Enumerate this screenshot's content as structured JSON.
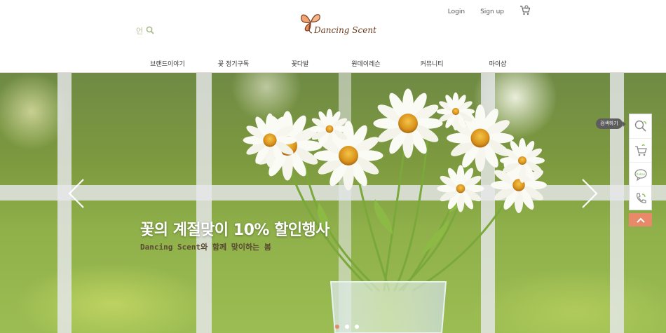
{
  "header": {
    "login_label": "Login",
    "signup_label": "Sign up",
    "language_label": "언",
    "cart_icon": "cart-icon",
    "search_icon": "search-icon"
  },
  "logo": {
    "text": "Dancing Scent"
  },
  "nav": {
    "items": [
      {
        "label": "브랜드이야기"
      },
      {
        "label": "꽃 정기구독"
      },
      {
        "label": "꽃다발"
      },
      {
        "label": "원데이레슨"
      },
      {
        "label": "커뮤니티"
      },
      {
        "label": "마이샵"
      }
    ]
  },
  "hero": {
    "title": "꽃의 계절맞이 10% 할인행사",
    "subtitle": "Dancing Scent와 함께 맞이하는 봄",
    "slide_count": 3,
    "active_slide": 1
  },
  "quick_menu": {
    "tooltip": "검색하기",
    "items": [
      {
        "icon": "search-icon"
      },
      {
        "icon": "cart-icon"
      },
      {
        "icon": "kakao-talk-icon",
        "label": "Kakao"
      },
      {
        "icon": "phone-icon"
      }
    ]
  },
  "colors": {
    "accent": "#e88a6a",
    "brand_brown": "#6b3b1d",
    "lang_green": "#b7c49c"
  }
}
